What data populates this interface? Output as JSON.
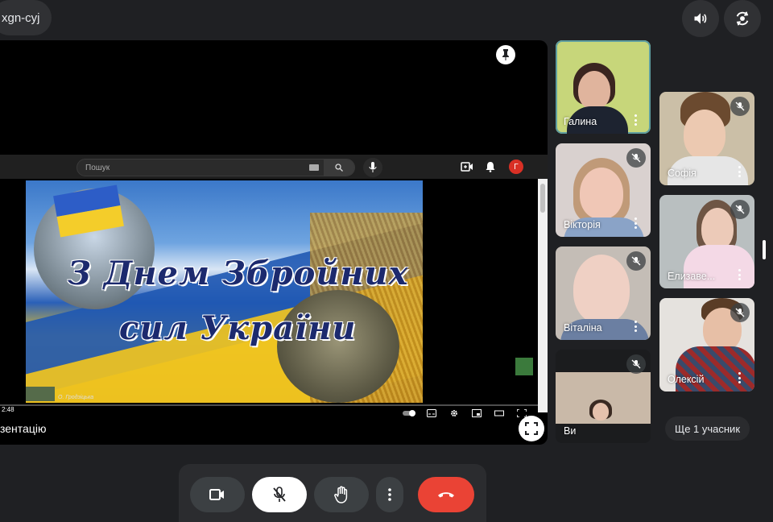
{
  "meeting": {
    "code": "xgn-cyj"
  },
  "top_buttons": {
    "speaker": "speaker-icon",
    "camera_switch": "switch-camera-icon"
  },
  "youtube": {
    "search_placeholder": "Пошук",
    "avatar_letter": "Г",
    "time": "2:48",
    "credit": "О. Гродзіцька",
    "poster_title_line1": "З Днем Збройних",
    "poster_title_line2": "сил України"
  },
  "stage": {
    "presenting_label": "зентацію"
  },
  "participants": [
    {
      "name": "Галина",
      "muted": false,
      "active": true
    },
    {
      "name": "Софія",
      "muted": true
    },
    {
      "name": "Вікторія",
      "muted": true
    },
    {
      "name": "Елизаве...",
      "muted": true
    },
    {
      "name": "Віталіна",
      "muted": true
    },
    {
      "name": "Олексій",
      "muted": true
    },
    {
      "name": "Ви",
      "muted": true
    }
  ],
  "more_participants": "Ще 1 учасник",
  "controls": {
    "camera": "camera-icon",
    "mic": "mic-off-icon",
    "hand": "raise-hand-icon",
    "more": "more-vert-icon",
    "end_call": "end-call-icon",
    "end_call_color": "#ea4335"
  }
}
